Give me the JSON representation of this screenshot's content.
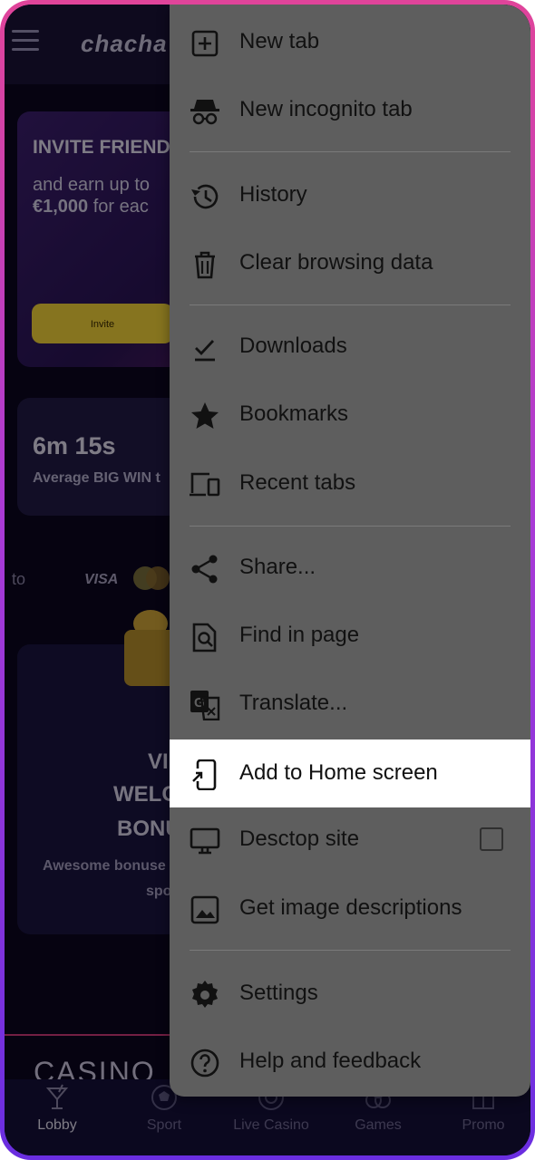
{
  "site": {
    "logo": "chacha",
    "invite": {
      "title": "INVITE FRIEND",
      "line1": "and earn up to",
      "line2_amount": "€1,000",
      "line2_rest": " for eac",
      "button": "Invite"
    },
    "stat": {
      "value": "6m 15s",
      "label": "Average BIG WIN t"
    },
    "payments": {
      "to": "to",
      "visa": "VISA"
    },
    "welcome": {
      "line1": "VI",
      "line2": "WELC",
      "line3": "BONU",
      "desc1": "Awesome bonuse",
      "desc2": "spo"
    },
    "section_title": "CASINO",
    "bottom_nav": [
      {
        "label": "Lobby",
        "icon": "cocktail-icon"
      },
      {
        "label": "Sport",
        "icon": "soccer-ball-icon"
      },
      {
        "label": "Live Casino",
        "icon": "roulette-icon"
      },
      {
        "label": "Games",
        "icon": "dice-icon"
      },
      {
        "label": "Promo",
        "icon": "gift-box-icon"
      }
    ]
  },
  "menu": {
    "items": [
      {
        "label": "New tab",
        "icon": "new-tab-icon"
      },
      {
        "label": "New incognito tab",
        "icon": "incognito-icon"
      },
      {
        "label": "History",
        "icon": "history-icon"
      },
      {
        "label": "Clear browsing data",
        "icon": "trash-icon"
      },
      {
        "label": "Downloads",
        "icon": "download-icon"
      },
      {
        "label": "Bookmarks",
        "icon": "star-icon"
      },
      {
        "label": "Recent tabs",
        "icon": "devices-icon"
      },
      {
        "label": "Share...",
        "icon": "share-icon"
      },
      {
        "label": "Find in page",
        "icon": "find-in-page-icon"
      },
      {
        "label": "Translate...",
        "icon": "translate-icon"
      },
      {
        "label": "Add to Home screen",
        "icon": "add-to-home-icon",
        "highlighted": true
      },
      {
        "label": "Desctop site",
        "icon": "desktop-icon",
        "checkbox": false
      },
      {
        "label": "Get image descriptions",
        "icon": "image-icon"
      },
      {
        "label": "Settings",
        "icon": "settings-gear-icon"
      },
      {
        "label": "Help and feedback",
        "icon": "help-icon"
      }
    ]
  },
  "colors": {
    "menu_bg": "#5e5e5e",
    "highlight_bg": "#ffffff",
    "frame_gradient_top": "#e0449a",
    "frame_gradient_bottom": "#6a2ee0",
    "invite_button": "#f5d33a"
  }
}
